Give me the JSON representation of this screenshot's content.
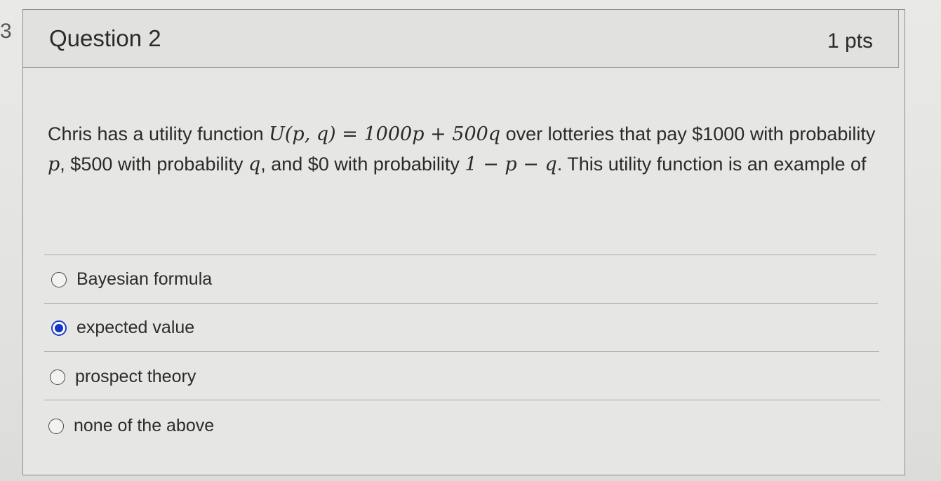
{
  "edge_mark": "3",
  "question": {
    "title": "Question 2",
    "points": "1 pts",
    "text": {
      "part1": "Chris has a utility function ",
      "math1": "U(p, q) = 1000p + 500q",
      "part2": " over lotteries that pay $1000 with probability ",
      "math2": "p",
      "part3": ", $500 with probability ",
      "math3": "q",
      "part4": ", and $0 with probability ",
      "math4": "1 − p − q",
      "part5": ". This utility function is an example of"
    }
  },
  "options": [
    {
      "label": "Bayesian formula",
      "selected": false
    },
    {
      "label": "expected value",
      "selected": true
    },
    {
      "label": "prospect theory",
      "selected": false
    },
    {
      "label": "none of the above",
      "selected": false
    }
  ],
  "colors": {
    "selected_radio": "#1237c9",
    "text": "#2b2b2b",
    "border": "#8c8c8c"
  }
}
